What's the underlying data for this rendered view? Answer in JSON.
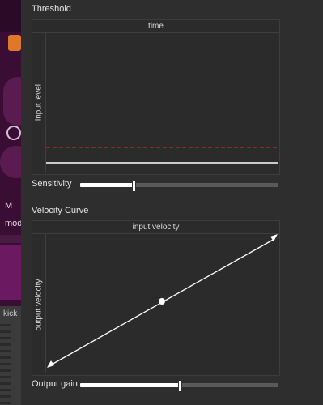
{
  "background_app": {
    "letter": "M",
    "mod_text": "mod",
    "track_name": "kick"
  },
  "threshold": {
    "section_title": "Threshold",
    "graph_title": "time",
    "y_label": "input level",
    "threshold_line_color": "#c23a3a",
    "signal_line_color": "#ffffff"
  },
  "sensitivity": {
    "label": "Sensitivity",
    "value": 0.27
  },
  "velocity_curve": {
    "section_title": "Velocity Curve",
    "graph_title": "input velocity",
    "y_label": "output velocity"
  },
  "output_gain": {
    "label": "Output gain",
    "value": 0.5
  }
}
